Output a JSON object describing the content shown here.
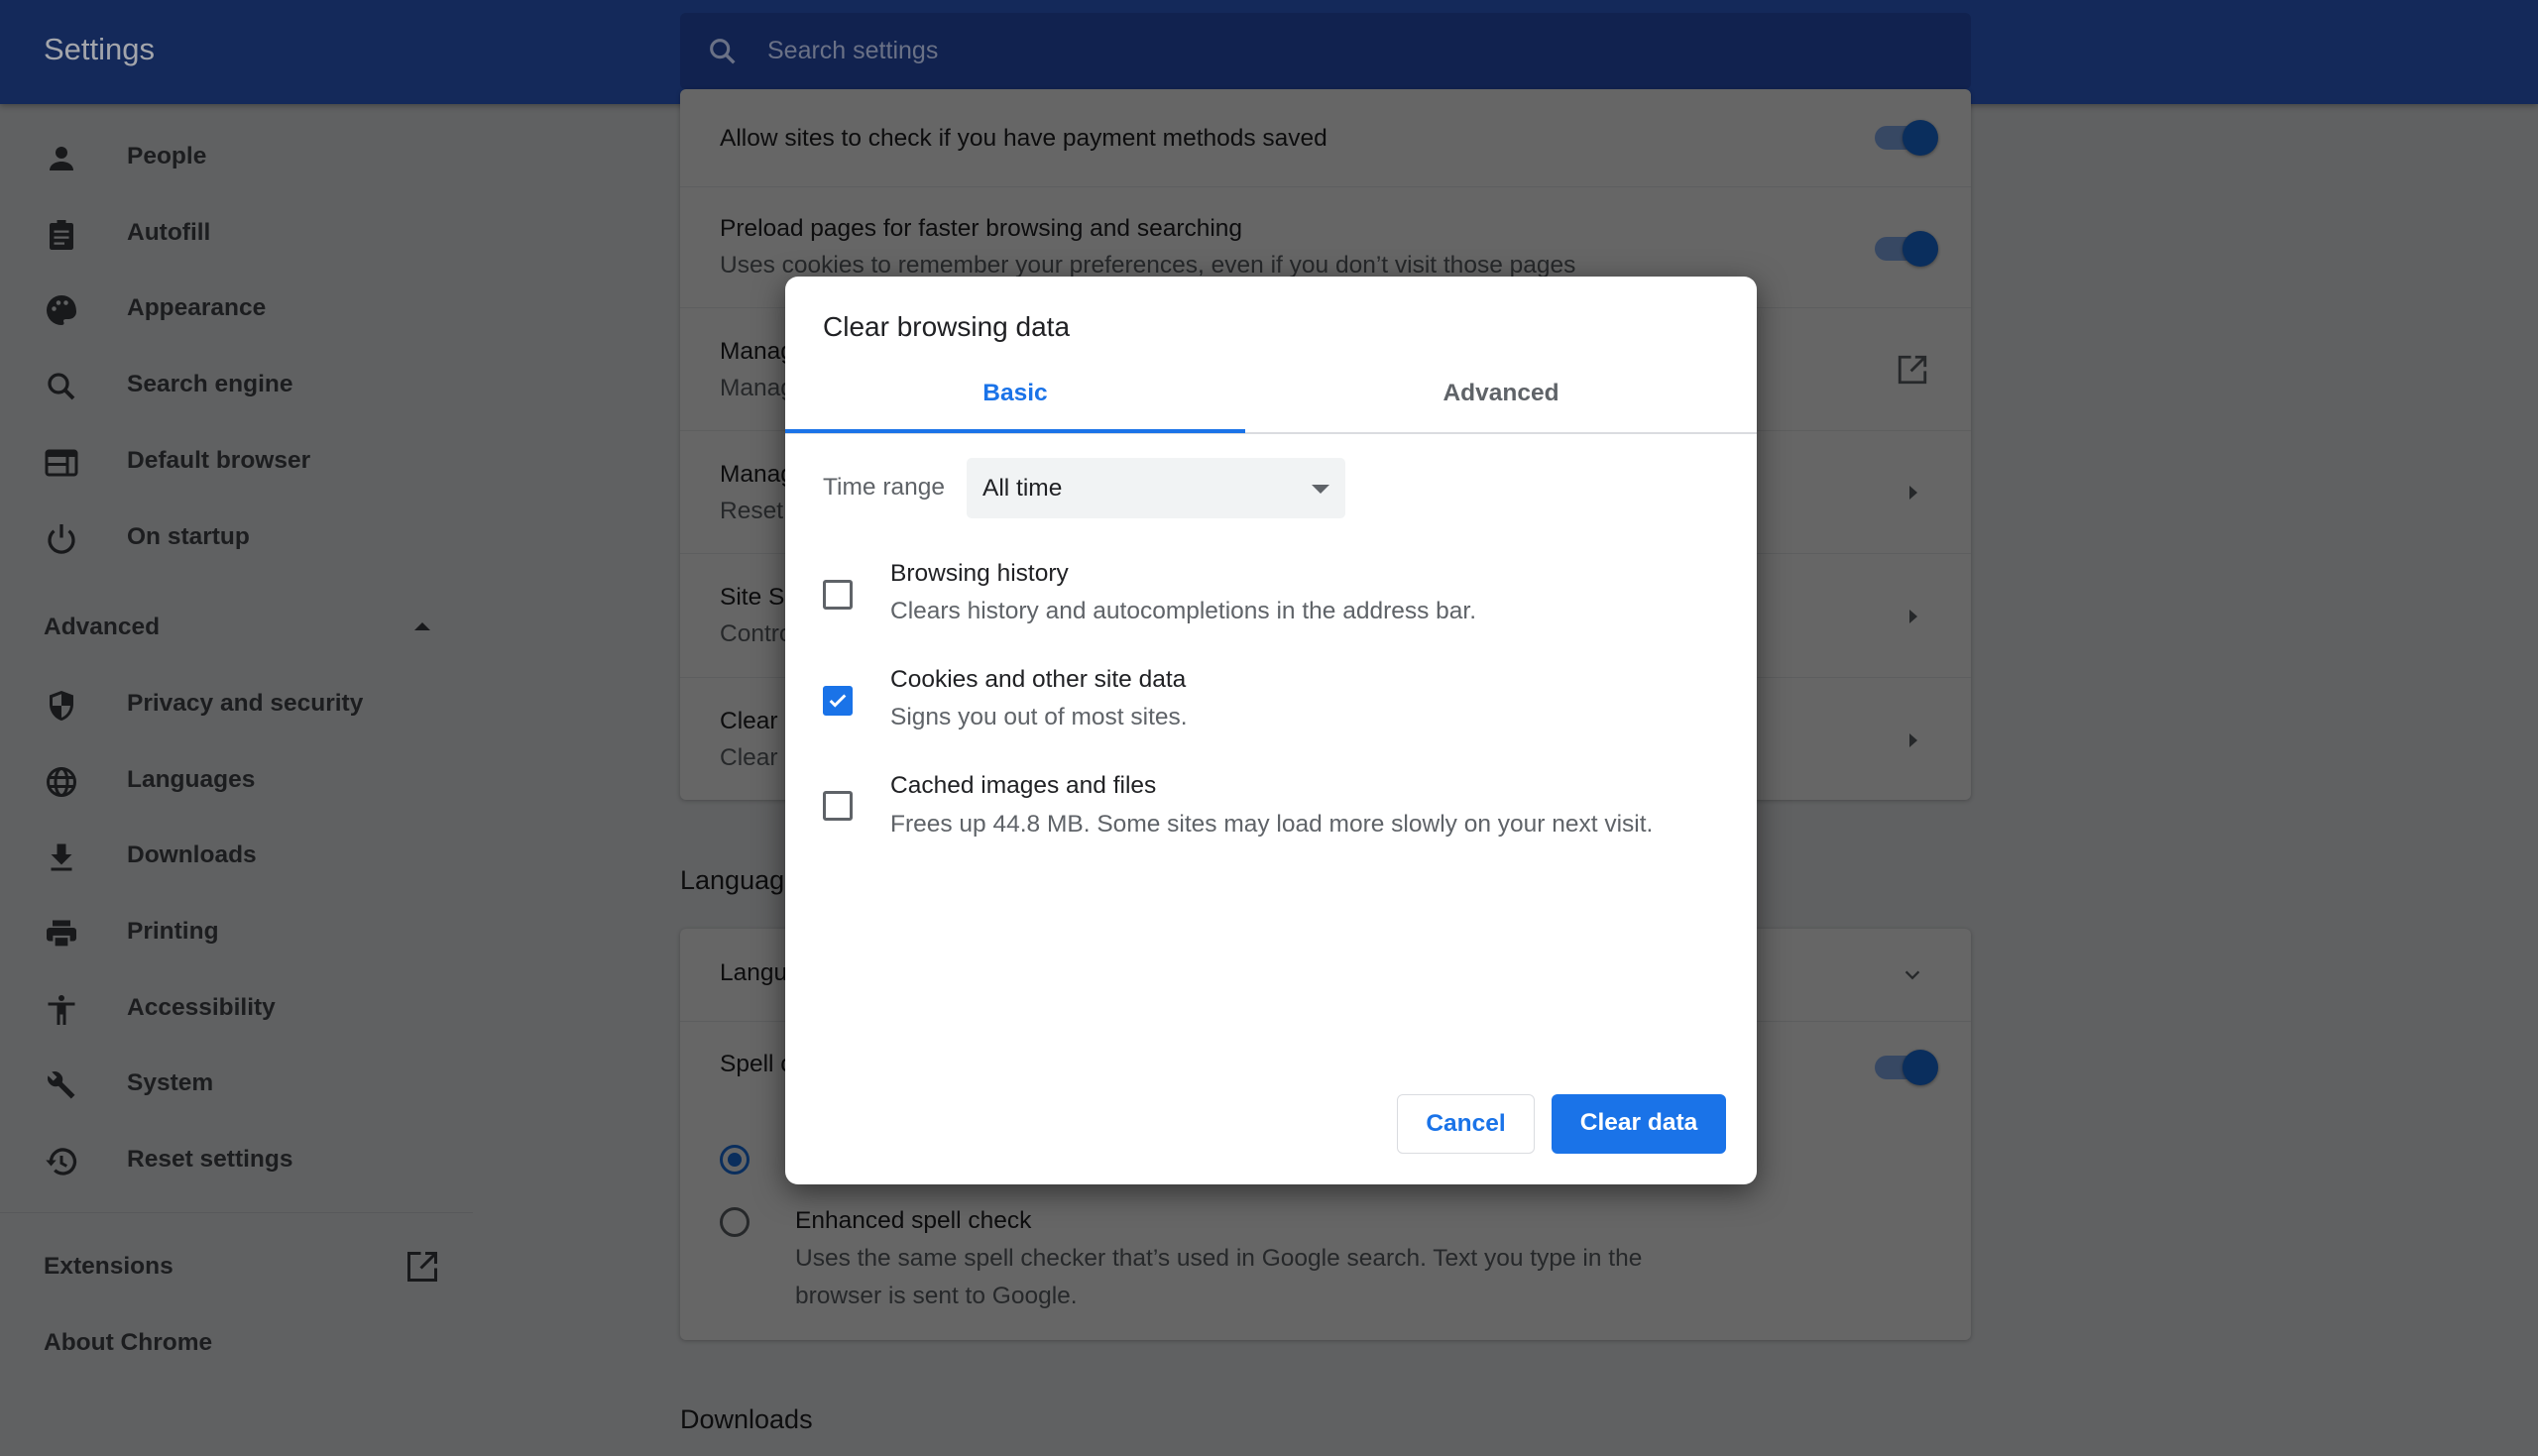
{
  "header": {
    "title": "Settings",
    "search_placeholder": "Search settings"
  },
  "sidebar": {
    "items": [
      {
        "label": "People",
        "icon": "person-icon"
      },
      {
        "label": "Autofill",
        "icon": "clipboard-icon"
      },
      {
        "label": "Appearance",
        "icon": "palette-icon"
      },
      {
        "label": "Search engine",
        "icon": "search-icon"
      },
      {
        "label": "Default browser",
        "icon": "browser-icon"
      },
      {
        "label": "On startup",
        "icon": "power-icon"
      }
    ],
    "advanced_label": "Advanced",
    "advanced_items": [
      {
        "label": "Privacy and security",
        "icon": "shield-icon"
      },
      {
        "label": "Languages",
        "icon": "globe-icon"
      },
      {
        "label": "Downloads",
        "icon": "download-icon"
      },
      {
        "label": "Printing",
        "icon": "printer-icon"
      },
      {
        "label": "Accessibility",
        "icon": "accessibility-icon"
      },
      {
        "label": "System",
        "icon": "wrench-icon"
      },
      {
        "label": "Reset settings",
        "icon": "history-icon"
      }
    ],
    "extensions_label": "Extensions",
    "about_label": "About Chrome"
  },
  "main": {
    "privacy_rows": [
      {
        "title": "Allow sites to check if you have payment methods saved"
      },
      {
        "title": "Preload pages for faster browsing and searching",
        "subtitle": "Uses cookies to remember your preferences, even if you don’t visit those pages"
      },
      {
        "title": "Manag",
        "subtitle": "Manag"
      },
      {
        "title": "Manag",
        "subtitle": "Reset"
      },
      {
        "title": "Site S",
        "subtitle": "Contro"
      },
      {
        "title": "Clear l",
        "subtitle": "Clear l"
      }
    ],
    "languages_heading": "Languag",
    "languages_rows": [
      {
        "title": "Langu"
      },
      {
        "title": "Spell c"
      }
    ],
    "enhanced_spell": {
      "title": "Enhanced spell check",
      "desc1": "Uses the same spell checker that’s used in Google search. Text you type in the",
      "desc2": "browser is sent to Google."
    },
    "downloads_heading": "Downloads"
  },
  "dialog": {
    "title": "Clear browsing data",
    "tabs": [
      "Basic",
      "Advanced"
    ],
    "active_tab": "Basic",
    "time_range_label": "Time range",
    "time_range_value": "All time",
    "items": [
      {
        "title": "Browsing history",
        "desc": "Clears history and autocompletions in the address bar.",
        "checked": false
      },
      {
        "title": "Cookies and other site data",
        "desc": "Signs you out of most sites.",
        "checked": true
      },
      {
        "title": "Cached images and files",
        "desc": "Frees up 44.8 MB. Some sites may load more slowly on your next visit.",
        "checked": false
      }
    ],
    "cancel_label": "Cancel",
    "confirm_label": "Clear data",
    "accent": "#1a73e8"
  }
}
